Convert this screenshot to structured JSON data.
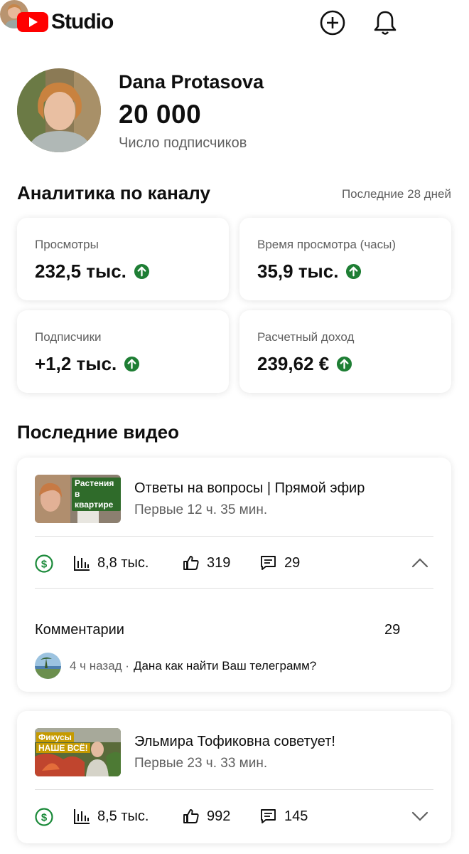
{
  "app": {
    "name": "Studio"
  },
  "channel": {
    "name": "Dana Protasova",
    "subscribers": "20 000",
    "subscribers_label": "Число подписчиков"
  },
  "analytics": {
    "title": "Аналитика по каналу",
    "period": "Последние 28 дней",
    "stats": [
      {
        "label": "Просмотры",
        "value": "232,5 тыс.",
        "trend": "up"
      },
      {
        "label": "Время просмотра (часы)",
        "value": "35,9 тыс.",
        "trend": "up"
      },
      {
        "label": "Подписчики",
        "value": "+1,2 тыс.",
        "trend": "up"
      },
      {
        "label": "Расчетный доход",
        "value": "239,62 €",
        "trend": "up"
      }
    ]
  },
  "recent": {
    "title": "Последние видео",
    "videos": [
      {
        "thumb_text": "Растения в квартире",
        "title": "Ответы на вопросы | Прямой эфир",
        "subtitle": "Первые 12 ч. 35 мин.",
        "views": "8,8 тыс.",
        "likes": "319",
        "comments": "29",
        "expanded": true,
        "comments_label": "Комментарии",
        "comments_total": "29",
        "latest_comment": {
          "time": "4 ч назад ·",
          "text": "Дана как найти Ваш телеграмм?"
        }
      },
      {
        "thumb_text_1": "Фикусы",
        "thumb_text_2": "НАШЕ ВСЁ!",
        "title": "Эльмира Тофиковна советует!",
        "subtitle": "Первые 23 ч. 33 мин.",
        "views": "8,5 тыс.",
        "likes": "992",
        "comments": "145",
        "expanded": false
      }
    ]
  },
  "colors": {
    "brand_red": "#ff0000",
    "trend_green": "#1e7e34",
    "monetize_green": "#1b8a3a",
    "secondary_text": "#606060"
  },
  "icons": [
    "youtube-logo-icon",
    "add-circle-icon",
    "bell-icon",
    "arrow-up-circle-icon",
    "dollar-circle-icon",
    "bar-chart-icon",
    "thumbs-up-icon",
    "comment-icon",
    "chevron-up-icon",
    "chevron-down-icon"
  ]
}
